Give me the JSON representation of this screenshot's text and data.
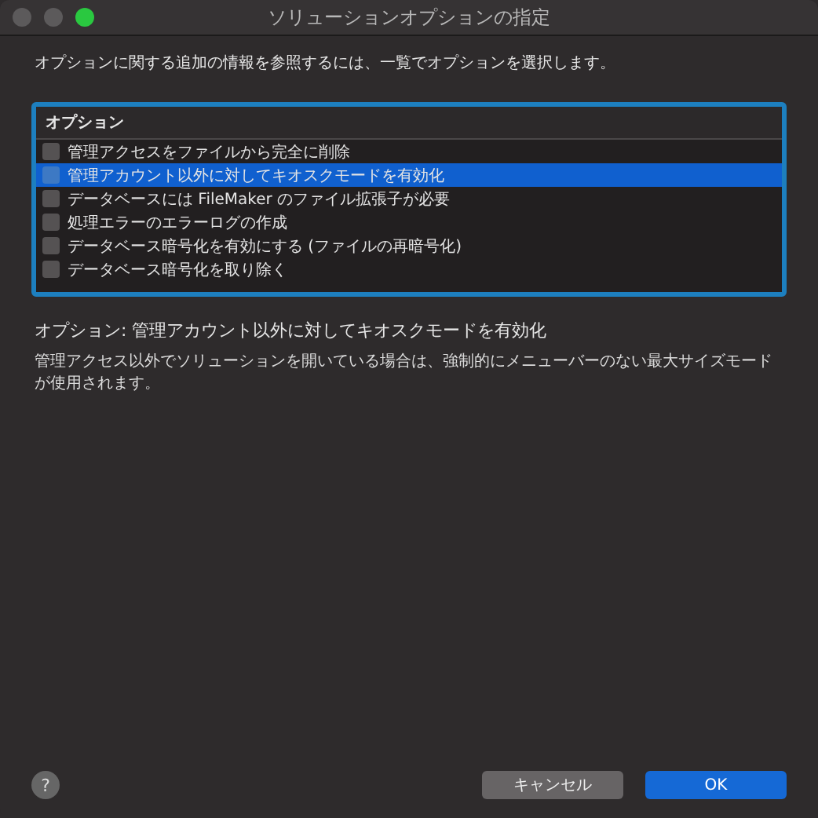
{
  "window": {
    "title": "ソリューションオプションの指定"
  },
  "instruction": "オプションに関する追加の情報を参照するには、一覧でオプションを選択します。",
  "options_list": {
    "header": "オプション",
    "items": [
      {
        "label": "管理アクセスをファイルから完全に削除",
        "checked": false,
        "selected": false
      },
      {
        "label": "管理アカウント以外に対してキオスクモードを有効化",
        "checked": false,
        "selected": true
      },
      {
        "label": "データベースには FileMaker のファイル拡張子が必要",
        "checked": false,
        "selected": false
      },
      {
        "label": "処理エラーのエラーログの作成",
        "checked": false,
        "selected": false
      },
      {
        "label": "データベース暗号化を有効にする (ファイルの再暗号化)",
        "checked": false,
        "selected": false
      },
      {
        "label": "データベース暗号化を取り除く",
        "checked": false,
        "selected": false
      }
    ]
  },
  "detail": {
    "title": "オプション:  管理アカウント以外に対してキオスクモードを有効化",
    "description": "管理アクセス以外でソリューションを開いている場合は、強制的にメニューバーのない最大サイズモードが使用されます。"
  },
  "help_button": "?",
  "buttons": [
    {
      "label": "キャンセル",
      "kind": "secondary"
    },
    {
      "label": "OK",
      "kind": "primary"
    }
  ]
}
